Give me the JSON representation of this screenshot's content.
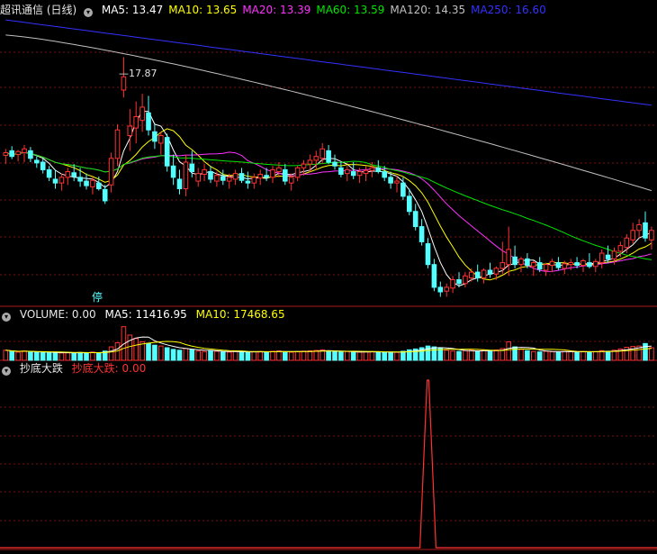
{
  "colors": {
    "background": "#000000",
    "grid": "#7a1010",
    "up": "#ff3232",
    "down": "#54ffff",
    "ma5": "#ffffff",
    "ma10": "#ffff00",
    "ma20": "#ff32ff",
    "ma60": "#00e600",
    "ma120": "#c0c0c0",
    "ma250": "#3232ff",
    "signal": "#ff3232"
  },
  "price_panel": {
    "title": "超讯通信 (日线)",
    "ma_labels": [
      {
        "key": "ma5",
        "text": "MA5: 13.47"
      },
      {
        "key": "ma10",
        "text": "MA10: 13.65"
      },
      {
        "key": "ma20",
        "text": "MA20: 13.39"
      },
      {
        "key": "ma60",
        "text": "MA60: 13.59"
      },
      {
        "key": "ma120",
        "text": "MA120: 14.35"
      },
      {
        "key": "ma250",
        "text": "MA250: 16.60"
      }
    ],
    "high_label": "17.87",
    "halt_label": "停"
  },
  "volume_panel": {
    "title": "VOLUME: 0.00",
    "ma5_label": "MA5: 11416.95",
    "ma10_label": "MA10: 17468.65"
  },
  "indicator_panel": {
    "title": "抄底大跌",
    "value_label": "抄底大跌: 0.00"
  },
  "chart_data": {
    "type": "candlestick",
    "ylim": [
      11.3,
      18.9
    ],
    "volume_ylim": [
      0,
      45000
    ],
    "candles": [
      [
        15.28,
        15.45,
        15.05,
        15.35
      ],
      [
        15.4,
        15.52,
        15.18,
        15.25
      ],
      [
        15.3,
        15.42,
        15.12,
        15.38
      ],
      [
        15.35,
        15.55,
        15.1,
        15.45
      ],
      [
        15.4,
        15.5,
        15.1,
        15.2
      ],
      [
        15.15,
        15.25,
        14.95,
        15.08
      ],
      [
        15.1,
        15.2,
        14.8,
        14.9
      ],
      [
        14.9,
        15.0,
        14.6,
        14.7
      ],
      [
        14.65,
        14.9,
        14.4,
        14.55
      ],
      [
        14.55,
        14.8,
        14.35,
        14.7
      ],
      [
        14.7,
        14.95,
        14.5,
        14.85
      ],
      [
        14.82,
        15.05,
        14.6,
        14.72
      ],
      [
        14.7,
        14.95,
        14.45,
        14.6
      ],
      [
        14.6,
        14.8,
        14.38,
        14.48
      ],
      [
        14.45,
        14.7,
        14.25,
        14.62
      ],
      [
        14.55,
        14.72,
        14.35,
        14.4
      ],
      [
        14.38,
        14.5,
        14.0,
        14.08
      ],
      [
        14.5,
        15.35,
        14.3,
        15.2
      ],
      [
        15.2,
        16.1,
        15.0,
        15.95
      ],
      [
        17.0,
        17.87,
        16.8,
        17.35
      ],
      [
        15.8,
        16.5,
        15.4,
        16.05
      ],
      [
        16.0,
        16.7,
        15.6,
        16.3
      ],
      [
        16.2,
        16.9,
        15.9,
        16.55
      ],
      [
        16.4,
        16.85,
        15.8,
        15.95
      ],
      [
        15.9,
        16.1,
        15.45,
        15.65
      ],
      [
        15.6,
        15.9,
        15.3,
        15.8
      ],
      [
        15.75,
        15.85,
        14.85,
        15.0
      ],
      [
        15.0,
        15.3,
        14.5,
        14.7
      ],
      [
        14.65,
        14.9,
        14.25,
        14.4
      ],
      [
        14.4,
        15.3,
        14.2,
        15.1
      ],
      [
        15.05,
        15.4,
        14.7,
        14.85
      ],
      [
        14.6,
        14.95,
        14.45,
        14.8
      ],
      [
        14.78,
        15.05,
        14.6,
        14.9
      ],
      [
        14.85,
        15.0,
        14.55,
        14.65
      ],
      [
        14.6,
        14.85,
        14.45,
        14.75
      ],
      [
        14.72,
        14.9,
        14.5,
        14.62
      ],
      [
        14.6,
        14.8,
        14.4,
        14.7
      ],
      [
        14.65,
        14.9,
        14.5,
        14.8
      ],
      [
        14.8,
        14.95,
        14.55,
        14.62
      ],
      [
        14.6,
        14.85,
        14.4,
        14.55
      ],
      [
        14.55,
        14.8,
        14.4,
        14.7
      ],
      [
        14.68,
        14.9,
        14.5,
        14.78
      ],
      [
        14.75,
        14.95,
        14.6,
        14.7
      ],
      [
        14.7,
        15.0,
        14.55,
        14.9
      ],
      [
        14.85,
        15.1,
        14.7,
        14.95
      ],
      [
        14.9,
        15.05,
        14.5,
        14.6
      ],
      [
        14.55,
        14.8,
        14.35,
        14.7
      ],
      [
        14.7,
        15.0,
        14.6,
        14.95
      ],
      [
        14.95,
        15.15,
        14.75,
        15.05
      ],
      [
        15.05,
        15.3,
        14.85,
        15.15
      ],
      [
        15.15,
        15.4,
        14.9,
        15.25
      ],
      [
        15.2,
        15.6,
        15.05,
        15.45
      ],
      [
        15.4,
        15.55,
        15.05,
        15.1
      ],
      [
        15.1,
        15.3,
        14.9,
        15.0
      ],
      [
        14.95,
        15.1,
        14.7,
        14.78
      ],
      [
        14.8,
        15.0,
        14.6,
        14.9
      ],
      [
        14.85,
        15.1,
        14.65,
        14.75
      ],
      [
        14.75,
        14.95,
        14.55,
        14.85
      ],
      [
        14.8,
        15.0,
        14.6,
        14.88
      ],
      [
        14.88,
        15.1,
        14.7,
        14.95
      ],
      [
        14.95,
        15.15,
        14.8,
        14.85
      ],
      [
        14.85,
        15.0,
        14.6,
        14.7
      ],
      [
        14.7,
        14.85,
        14.4,
        14.55
      ],
      [
        14.55,
        14.75,
        14.3,
        14.6
      ],
      [
        14.55,
        14.7,
        14.1,
        14.2
      ],
      [
        14.2,
        14.4,
        13.7,
        13.8
      ],
      [
        13.8,
        14.0,
        13.3,
        13.4
      ],
      [
        13.4,
        13.6,
        12.9,
        13.0
      ],
      [
        12.95,
        13.1,
        12.3,
        12.4
      ],
      [
        12.4,
        12.55,
        11.7,
        11.8
      ],
      [
        11.8,
        11.95,
        11.55,
        11.68
      ],
      [
        11.7,
        11.9,
        11.55,
        11.8
      ],
      [
        11.78,
        12.1,
        11.65,
        12.0
      ],
      [
        12.0,
        12.2,
        11.8,
        11.9
      ],
      [
        11.9,
        12.2,
        11.8,
        12.1
      ],
      [
        12.05,
        12.3,
        11.95,
        12.2
      ],
      [
        12.2,
        12.4,
        11.95,
        12.05
      ],
      [
        12.05,
        12.3,
        11.9,
        12.25
      ],
      [
        12.25,
        12.45,
        12.05,
        12.15
      ],
      [
        12.15,
        12.35,
        12.0,
        12.3
      ],
      [
        12.3,
        13.0,
        12.15,
        12.45
      ],
      [
        12.4,
        13.4,
        12.1,
        12.8
      ],
      [
        12.6,
        12.9,
        12.3,
        12.4
      ],
      [
        12.4,
        12.6,
        12.2,
        12.55
      ],
      [
        12.55,
        12.7,
        12.3,
        12.38
      ],
      [
        12.35,
        12.5,
        12.1,
        12.45
      ],
      [
        12.45,
        12.6,
        12.2,
        12.28
      ],
      [
        12.25,
        12.45,
        12.1,
        12.4
      ],
      [
        12.38,
        12.55,
        12.2,
        12.48
      ],
      [
        12.45,
        12.6,
        12.25,
        12.32
      ],
      [
        12.3,
        12.5,
        12.15,
        12.42
      ],
      [
        12.4,
        12.55,
        12.25,
        12.45
      ],
      [
        12.45,
        12.6,
        12.3,
        12.38
      ],
      [
        12.38,
        12.55,
        12.2,
        12.5
      ],
      [
        12.45,
        12.7,
        12.3,
        12.35
      ],
      [
        12.35,
        12.55,
        12.2,
        12.48
      ],
      [
        12.45,
        12.8,
        12.3,
        12.7
      ],
      [
        12.65,
        12.9,
        12.45,
        12.55
      ],
      [
        12.55,
        12.85,
        12.4,
        12.75
      ],
      [
        12.75,
        13.0,
        12.6,
        12.9
      ],
      [
        12.85,
        13.2,
        12.7,
        13.1
      ],
      [
        13.05,
        13.5,
        12.95,
        13.3
      ],
      [
        13.3,
        13.6,
        13.1,
        13.45
      ],
      [
        13.5,
        13.8,
        13.0,
        13.1
      ],
      [
        13.05,
        13.4,
        12.8,
        13.3
      ]
    ],
    "volumes": [
      12000,
      10500,
      9800,
      11000,
      10200,
      9600,
      9000,
      8800,
      9500,
      8700,
      9200,
      8900,
      9400,
      8600,
      9800,
      9000,
      11000,
      16000,
      21000,
      40000,
      30000,
      26000,
      22000,
      20000,
      18000,
      17000,
      15000,
      13000,
      12000,
      14000,
      12500,
      11000,
      10500,
      11500,
      10800,
      10000,
      9800,
      10600,
      10200,
      9700,
      10100,
      10400,
      9900,
      10800,
      11200,
      10300,
      9600,
      10500,
      10900,
      11300,
      11800,
      12500,
      10700,
      10200,
      9800,
      10300,
      10000,
      9700,
      10100,
      10400,
      9900,
      9500,
      9300,
      9600,
      10800,
      12500,
      13500,
      15000,
      17000,
      16000,
      14000,
      12000,
      11000,
      10500,
      11500,
      12000,
      10800,
      11800,
      11000,
      12300,
      14000,
      22000,
      16000,
      13000,
      11500,
      10500,
      10000,
      10800,
      10300,
      9900,
      10600,
      10200,
      9800,
      10500,
      10100,
      10400,
      11500,
      10800,
      12000,
      13500,
      15500,
      16500,
      17000,
      20000,
      15000
    ],
    "ma_series_last": {
      "ma5": 13.47,
      "ma10": 13.65,
      "ma20": 13.39,
      "ma60": 13.59,
      "ma120": 14.35,
      "ma250": 16.6
    },
    "volume_series_last": {
      "ma5": 11416.95,
      "ma10": 17468.65
    },
    "signal": {
      "baseline": 0,
      "peak": 1,
      "active_from_index": 67,
      "active_to_index": 69
    },
    "grid": true
  }
}
